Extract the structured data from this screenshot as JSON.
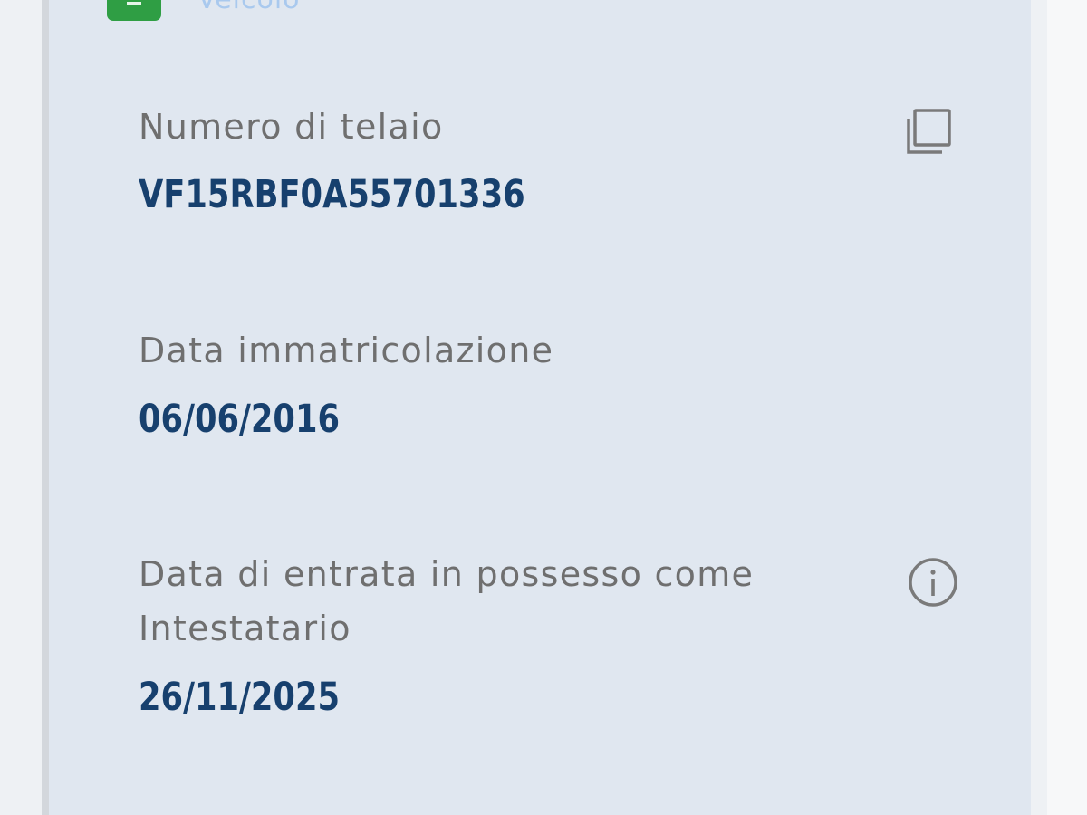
{
  "header": {
    "section_title": "Veicolo"
  },
  "fields": [
    {
      "label": "Numero di telaio",
      "value": "VF15RBF0A55701336",
      "action_icon": "copy-icon"
    },
    {
      "label": "Data immatricolazione",
      "value": "06/06/2016"
    },
    {
      "label_line1": "Data di entrata in possesso come",
      "label_line2": "Intestatario",
      "value": "26/11/2025",
      "action_icon": "info-icon"
    }
  ],
  "colors": {
    "card_background": "#e0e7f0",
    "label_text": "#6f6f6f",
    "value_text": "#17406e",
    "badge_green": "#2f9e44",
    "icon_gray": "#7a7a7a"
  }
}
